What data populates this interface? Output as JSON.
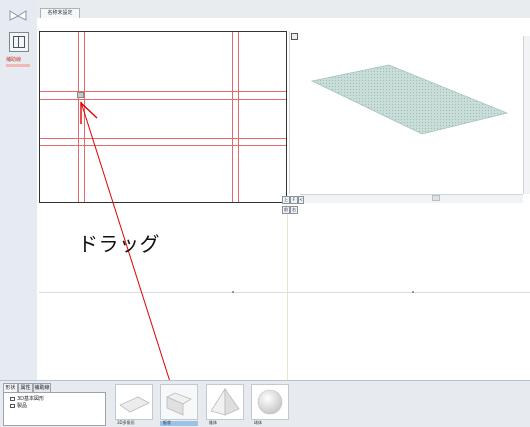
{
  "tabs": {
    "active_tab": "名称未設定"
  },
  "left_toolbar": {
    "label": "補助線"
  },
  "view_controls": [
    "上",
    "F",
    "<",
    "前",
    "右"
  ],
  "bottom_panel": {
    "tabs": [
      "形状",
      "属性",
      "補助線"
    ],
    "tree": {
      "root": "3D基本図形",
      "child": "製品"
    },
    "thumbnails": [
      "3D多角形",
      "板状",
      "錐体",
      "球体"
    ]
  },
  "annotation": {
    "text": "ドラッグ",
    "arrow_color": "#e00000",
    "check_color": "#e00000"
  },
  "colors": {
    "guide_line": "#e26a6a",
    "selection": "#9cc3e6"
  }
}
